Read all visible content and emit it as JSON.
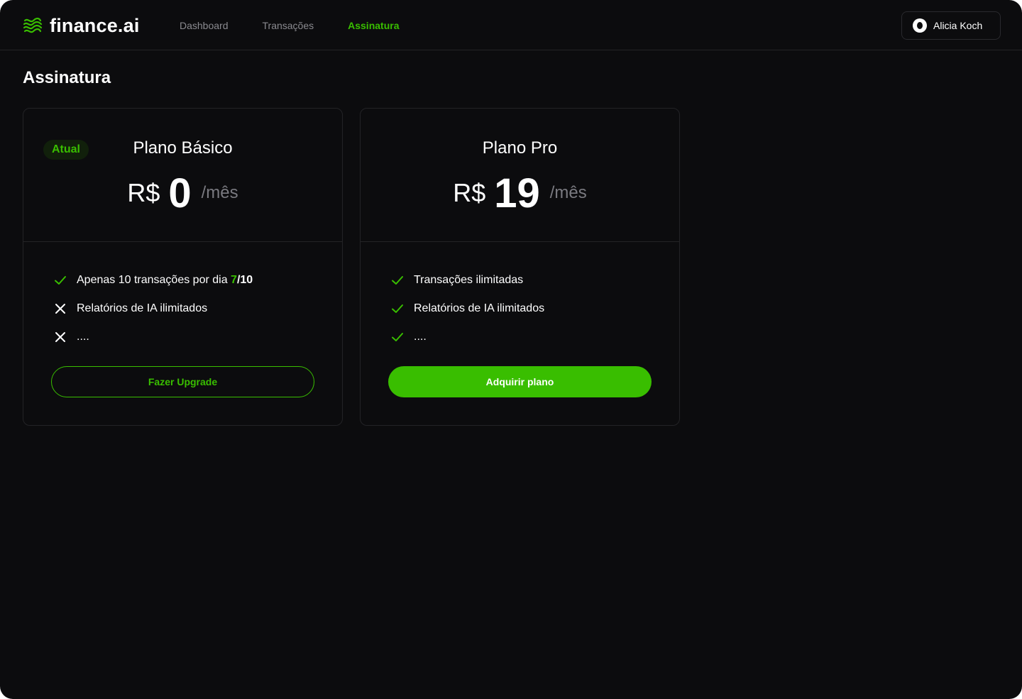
{
  "header": {
    "logo_text": "finance.ai",
    "nav": [
      {
        "label": "Dashboard",
        "active": false
      },
      {
        "label": "Transações",
        "active": false
      },
      {
        "label": "Assinatura",
        "active": true
      }
    ],
    "user": {
      "name": "Alicia Koch"
    }
  },
  "page": {
    "title": "Assinatura"
  },
  "plans": {
    "basic": {
      "badge": "Atual",
      "name": "Plano Básico",
      "currency": "R$",
      "amount": "0",
      "period": "/mês",
      "features": [
        {
          "icon": "check-icon",
          "text": "Apenas 10 transações por dia ",
          "used": "7",
          "total": "/10"
        },
        {
          "icon": "close-icon",
          "text": "Relatórios de IA ilimitados"
        },
        {
          "icon": "close-icon",
          "text": "...."
        }
      ],
      "button_label": "Fazer Upgrade"
    },
    "pro": {
      "name": "Plano Pro",
      "currency": "R$",
      "amount": "19",
      "period": "/mês",
      "features": [
        {
          "icon": "check-icon",
          "text": "Transações ilimitadas"
        },
        {
          "icon": "check-icon",
          "text": "Relatórios de IA ilimitados"
        },
        {
          "icon": "check-icon",
          "text": "...."
        }
      ],
      "button_label": "Adquirir plano"
    }
  },
  "colors": {
    "accent": "#39be00",
    "background": "#0c0c0e",
    "border": "#232326",
    "muted_text": "#8a8a8f"
  }
}
